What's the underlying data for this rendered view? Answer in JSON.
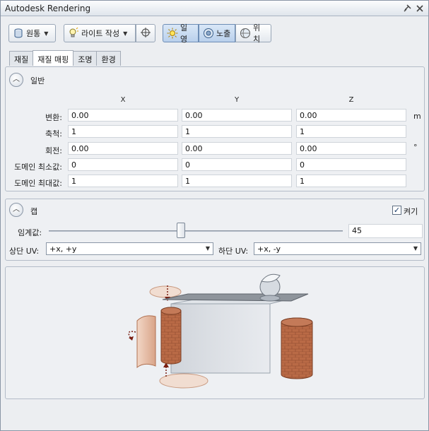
{
  "window": {
    "title": "Autodesk Rendering",
    "pin_icon": "pin-icon",
    "close_icon": "close-icon"
  },
  "toolbar": {
    "shape": {
      "label": "원통",
      "icon": "cylinder-icon"
    },
    "light": {
      "label": "라이트 작성",
      "icon": "bulb-icon"
    },
    "target_icon": "crosshair-icon",
    "sun": {
      "label": "일영",
      "icon": "sun-icon"
    },
    "exposure": {
      "label": "노출",
      "icon": "exposure-icon"
    },
    "location": {
      "label": "위치",
      "icon": "globe-icon"
    }
  },
  "tabs": [
    {
      "label": "재질"
    },
    {
      "label": "재질 매핑"
    },
    {
      "label": "조명"
    },
    {
      "label": "환경"
    }
  ],
  "general": {
    "title": "일반",
    "columns": [
      "X",
      "Y",
      "Z"
    ],
    "rows": [
      {
        "label": "변환:",
        "values": [
          "0.00",
          "0.00",
          "0.00"
        ],
        "unit": "m"
      },
      {
        "label": "축척:",
        "values": [
          "1",
          "1",
          "1"
        ],
        "unit": ""
      },
      {
        "label": "회전:",
        "values": [
          "0.00",
          "0.00",
          "0.00"
        ],
        "unit": "°"
      },
      {
        "label": "도메인 최소값:",
        "values": [
          "0",
          "0",
          "0"
        ],
        "unit": ""
      },
      {
        "label": "도메인 최대값:",
        "values": [
          "1",
          "1",
          "1"
        ],
        "unit": ""
      }
    ]
  },
  "cap": {
    "title": "캡",
    "enabled_label": "켜기",
    "enabled": true,
    "threshold_label": "임계값:",
    "threshold_value": "45",
    "threshold_fraction": 0.45,
    "top_uv_label": "상단 UV:",
    "top_uv_value": "+x, +y",
    "bottom_uv_label": "하단 UV:",
    "bottom_uv_value": "+x, -y"
  },
  "colors": {
    "accent": "#b9d0ec",
    "brick": "#b5603c",
    "panel": "#eef0f3"
  }
}
